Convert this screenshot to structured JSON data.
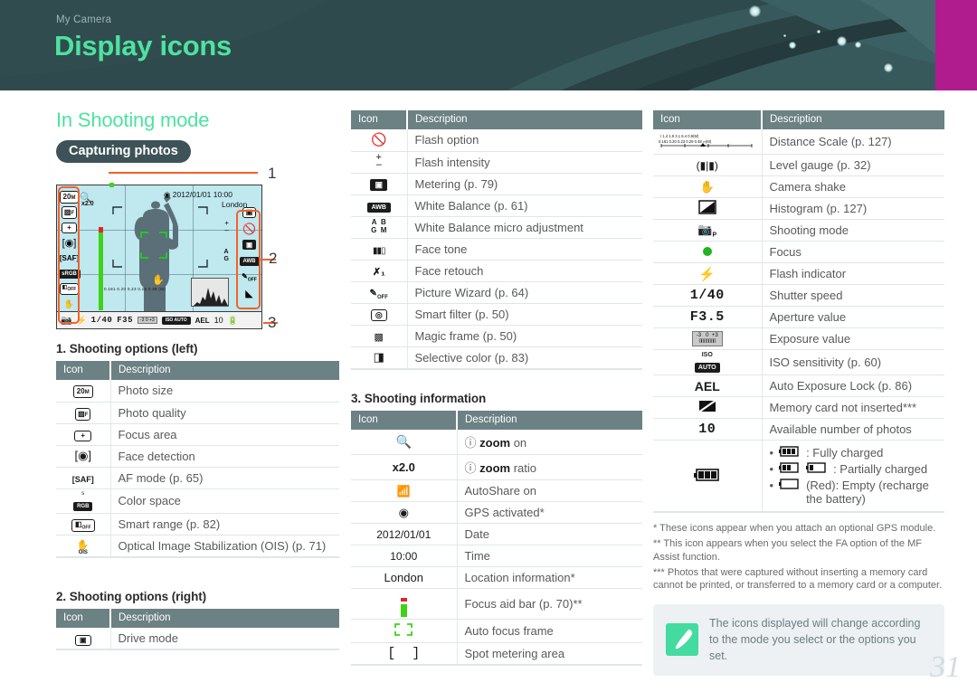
{
  "header": {
    "subtitle": "My Camera",
    "title": "Display icons",
    "accent_color": "#4de3a0",
    "bg_color": "#2f4a4c",
    "magenta_color": "#b01b8e"
  },
  "main_heading": "In Shooting mode",
  "pill_label": "Capturing photos",
  "preview": {
    "date": "2012/01/01",
    "time": "10:00",
    "location": "London",
    "zoom_ratio": "x2.0",
    "shutter": "1/40",
    "aperture": "F35",
    "ev": "-3      0     +3",
    "iso": "ISO AUTO",
    "ael": "AEL",
    "shots": "10",
    "distance_scale": "0.181  0.20  0.23  0.29  0.48  (M)",
    "left_icons": [
      "20M",
      "quality-F",
      "focus-area-plus",
      "face-detect",
      "SAF",
      "S.RGB",
      "smart-range-off",
      "OIS"
    ],
    "right_icons": [
      "drive-mode",
      "flash-intensity",
      "flash-option",
      "metering",
      "white-balance-auto",
      "AB-GM",
      "picture-wizard-off",
      "selective-color"
    ],
    "callouts": [
      "1",
      "2",
      "3"
    ]
  },
  "table1": {
    "title": "1. Shooting options (left)",
    "headers": [
      "Icon",
      "Description"
    ],
    "rows": [
      {
        "icon": "photo-size-20m",
        "desc": "Photo size"
      },
      {
        "icon": "photo-quality-f",
        "desc": "Photo quality"
      },
      {
        "icon": "focus-area-plus",
        "desc": "Focus area"
      },
      {
        "icon": "face-detection",
        "desc": "Face detection"
      },
      {
        "icon": "af-mode-saf",
        "desc": "AF mode (p. 65)"
      },
      {
        "icon": "color-space-srgb",
        "desc": "Color space"
      },
      {
        "icon": "smart-range-off",
        "desc": "Smart range (p. 82)"
      },
      {
        "icon": "ois",
        "desc": "Optical Image Stabilization (OIS) (p. 71)"
      }
    ]
  },
  "table2": {
    "title": "2. Shooting options (right)",
    "headers": [
      "Icon",
      "Description"
    ],
    "rows": [
      {
        "icon": "drive-mode",
        "desc": "Drive mode"
      }
    ]
  },
  "table3": {
    "headers": [
      "Icon",
      "Description"
    ],
    "rows": [
      {
        "icon": "flash-off",
        "desc": "Flash option"
      },
      {
        "icon": "flash-intensity-plusminus",
        "desc": "Flash intensity"
      },
      {
        "icon": "metering",
        "desc": "Metering (p. 79)"
      },
      {
        "icon": "white-balance-auto",
        "desc": "White Balance (p. 61)"
      },
      {
        "icon": "wb-micro-abgm",
        "desc": "White Balance micro adjustment"
      },
      {
        "icon": "face-tone",
        "desc": "Face tone"
      },
      {
        "icon": "face-retouch",
        "desc": "Face retouch"
      },
      {
        "icon": "picture-wizard-off",
        "desc": "Picture Wizard (p. 64)"
      },
      {
        "icon": "smart-filter",
        "desc": "Smart filter (p. 50)"
      },
      {
        "icon": "magic-frame",
        "desc": "Magic frame (p. 50)"
      },
      {
        "icon": "selective-color",
        "desc": "Selective color (p. 83)"
      }
    ]
  },
  "table4": {
    "title": "3. Shooting information",
    "headers": [
      "Icon",
      "Description"
    ],
    "rows": [
      {
        "icon": "magnifier",
        "desc": "zoom on",
        "prefix_i": true,
        "kw": "zoom",
        "suffix": " on"
      },
      {
        "icon": "text-x2.0",
        "text": "x2.0",
        "desc": "zoom ratio",
        "prefix_i": true,
        "kw": "zoom",
        "suffix": " ratio"
      },
      {
        "icon": "autoshare",
        "desc": "AutoShare on"
      },
      {
        "icon": "gps",
        "desc": "GPS activated*"
      },
      {
        "icon": "text-date",
        "text": "2012/01/01",
        "desc": "Date"
      },
      {
        "icon": "text-time",
        "text": "10:00",
        "desc": "Time"
      },
      {
        "icon": "text-location",
        "text": "London",
        "desc": "Location information*"
      },
      {
        "icon": "focus-aid-bar",
        "desc": "Focus aid bar (p. 70)**"
      },
      {
        "icon": "auto-focus-frame",
        "desc": "Auto focus frame"
      },
      {
        "icon": "spot-metering-area",
        "desc": "Spot metering area"
      }
    ]
  },
  "table5": {
    "headers": [
      "Icon",
      "Description"
    ],
    "rows": [
      {
        "icon": "distance-scale",
        "desc": "Distance Scale (p. 127)"
      },
      {
        "icon": "level-gauge",
        "desc": "Level gauge (p. 32)"
      },
      {
        "icon": "camera-shake",
        "desc": "Camera shake"
      },
      {
        "icon": "histogram",
        "desc": "Histogram (p. 127)"
      },
      {
        "icon": "shooting-mode",
        "desc": "Shooting mode"
      },
      {
        "icon": "focus-dot",
        "desc": "Focus"
      },
      {
        "icon": "flash-indicator",
        "desc": "Flash indicator"
      },
      {
        "icon": "text-shutter",
        "text": "1/40",
        "desc": "Shutter speed"
      },
      {
        "icon": "text-aperture",
        "text": "F3.5",
        "desc": "Aperture value"
      },
      {
        "icon": "exposure-value",
        "desc": "Exposure value"
      },
      {
        "icon": "iso",
        "desc": "ISO sensitivity (p. 60)"
      },
      {
        "icon": "text-ael",
        "text": "AEL",
        "desc": "Auto Exposure Lock (p. 86)"
      },
      {
        "icon": "no-memory-card",
        "desc": "Memory card not inserted***"
      },
      {
        "icon": "text-shots",
        "text": "10",
        "desc": "Available number of photos"
      },
      {
        "icon": "battery-full",
        "desc": "battery-list"
      }
    ],
    "battery_items": [
      {
        "icon": "battery-full",
        "label": ": Fully charged"
      },
      {
        "icon": "battery-two-one",
        "label": ": Partially charged"
      },
      {
        "icon": "battery-empty",
        "label": " (Red): Empty (recharge the battery)"
      }
    ]
  },
  "footnotes": [
    "* These icons appear when you attach an optional GPS module.",
    "** This icon appears when you select the FA option of the MF Assist function.",
    "*** Photos that were captured without inserting a memory card cannot be printed, or transferred to a memory card or a computer."
  ],
  "tip": {
    "icon": "pen-icon",
    "text": "The icons displayed will change according to the mode you select or the options you set."
  },
  "page_number": "31"
}
